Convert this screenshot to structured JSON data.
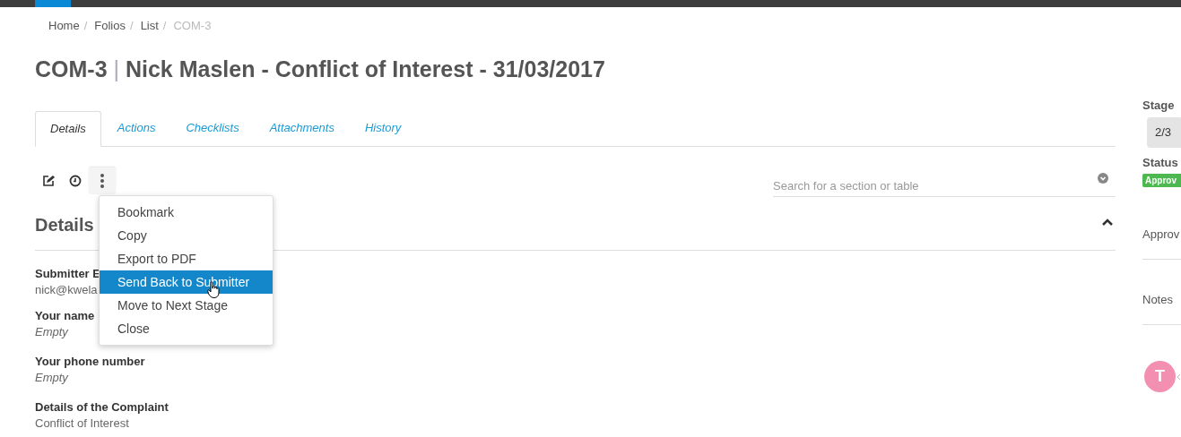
{
  "breadcrumb": [
    {
      "label": "Home",
      "current": false,
      "separator": "/"
    },
    {
      "label": "Folios",
      "current": false,
      "separator": "/"
    },
    {
      "label": "List",
      "current": false,
      "separator": "/"
    },
    {
      "label": "COM-3",
      "current": true
    }
  ],
  "title": {
    "code": "COM-3",
    "separator": "|",
    "name": "Nick Maslen - Conflict of Interest - 31/03/2017"
  },
  "tabs": [
    {
      "label": "Details",
      "selected": true
    },
    {
      "label": "Actions",
      "selected": false
    },
    {
      "label": "Checklists",
      "selected": false
    },
    {
      "label": "Attachments",
      "selected": false
    },
    {
      "label": "History",
      "selected": false
    }
  ],
  "search": {
    "placeholder": "Search for a section or table"
  },
  "menu": {
    "open": true,
    "items": [
      {
        "label": "Bookmark",
        "selected": false
      },
      {
        "label": "Copy",
        "selected": false
      },
      {
        "label": "Export to PDF",
        "selected": false
      },
      {
        "label": "Send Back to Submitter",
        "selected": true
      },
      {
        "label": "Move to Next Stage",
        "selected": false
      },
      {
        "label": "Close",
        "selected": false
      }
    ]
  },
  "section": {
    "title": "Details",
    "expanded": true,
    "fields": [
      {
        "label": "Submitter E",
        "value": "nick@kwela",
        "empty": false
      },
      {
        "label": "Your name",
        "value": "Empty",
        "empty": true
      },
      {
        "label": "Your phone number",
        "value": "Empty",
        "empty": true
      },
      {
        "label": "Details of the Complaint",
        "value": "Conflict of Interest",
        "empty": false
      }
    ]
  },
  "sidebar": {
    "stage_label": "Stage",
    "stage": "2/3",
    "status_label": "Status",
    "status": "Approv",
    "approvals_label": "Approv",
    "notes_label": "Notes",
    "avatar": "T"
  }
}
